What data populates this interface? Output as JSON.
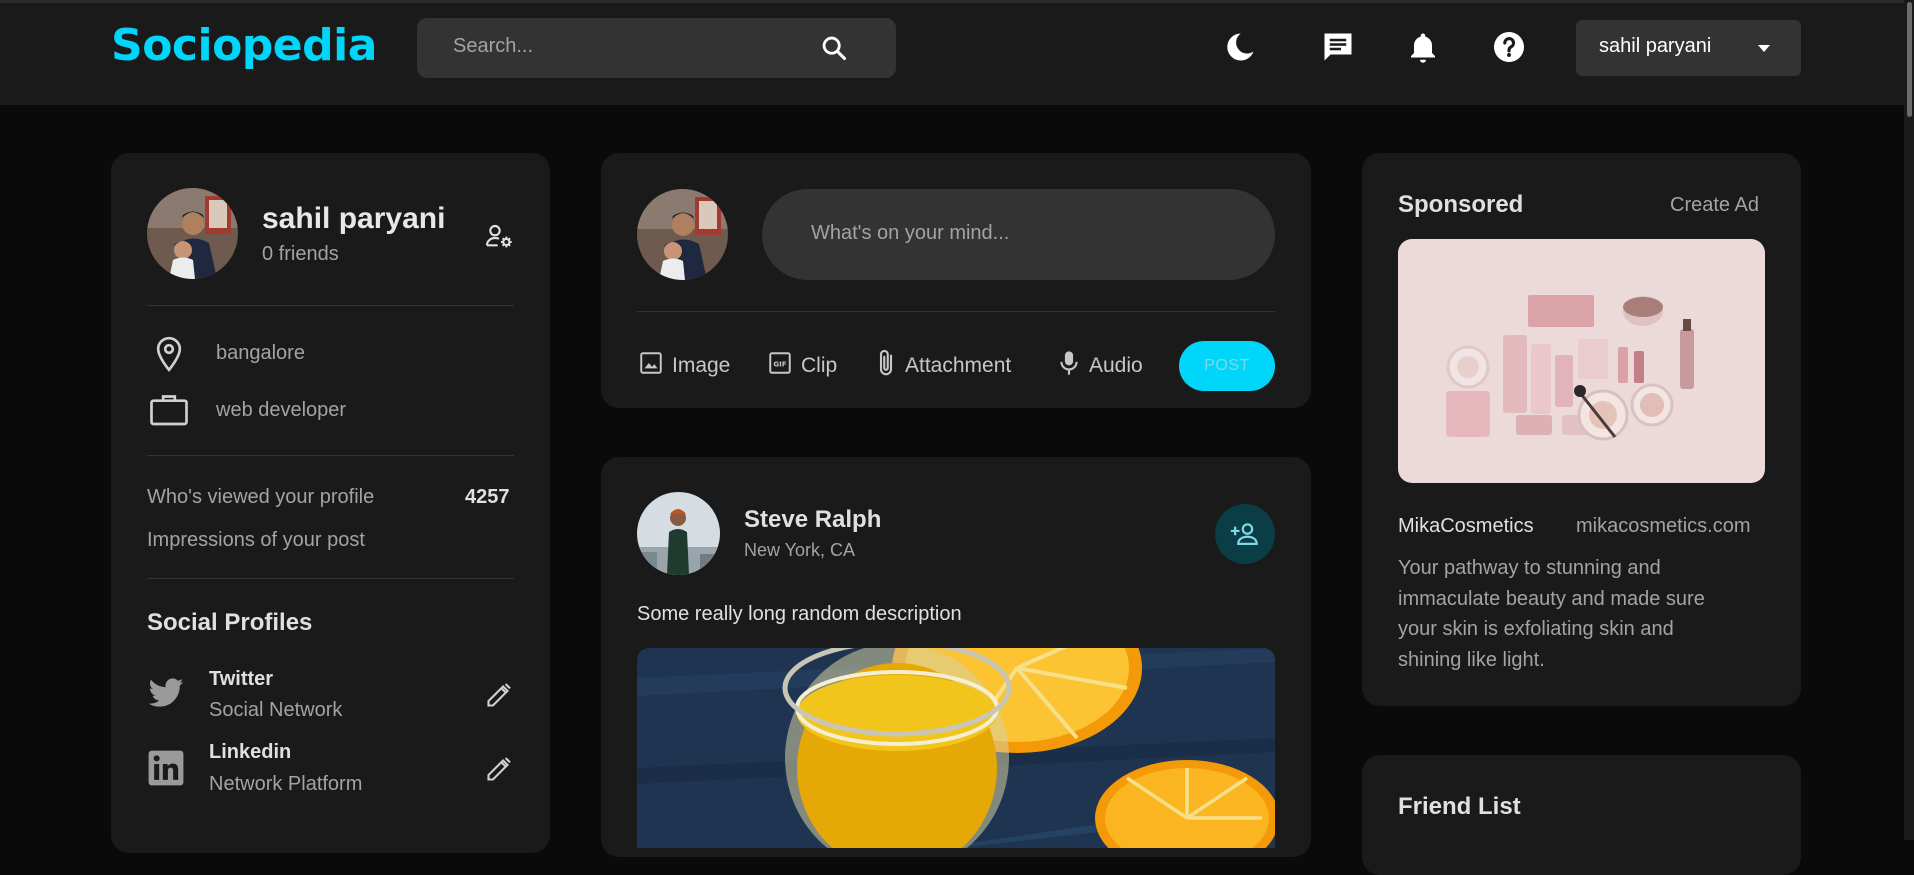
{
  "navbar": {
    "logo": "Sociopedia",
    "search_placeholder": "Search...",
    "user_select": "sahil paryani"
  },
  "profile": {
    "name": "sahil paryani",
    "friends": "0 friends",
    "location": "bangalore",
    "occupation": "web developer",
    "viewed_label": "Who's viewed your profile",
    "viewed_value": "4257",
    "impressions_label": "Impressions of your post",
    "social_title": "Social Profiles",
    "socials": [
      {
        "name": "Twitter",
        "type": "Social Network"
      },
      {
        "name": "Linkedin",
        "type": "Network Platform"
      }
    ]
  },
  "composer": {
    "placeholder": "What's on your mind...",
    "tools": [
      "Image",
      "Clip",
      "Attachment",
      "Audio"
    ],
    "post_label": "POST"
  },
  "post": {
    "author": "Steve Ralph",
    "location": "New York, CA",
    "description": "Some really long random description"
  },
  "sponsored": {
    "title": "Sponsored",
    "create_ad": "Create Ad",
    "brand": "MikaCosmetics",
    "site": "mikacosmetics.com",
    "description_lines": [
      "Your pathway to stunning and",
      "immaculate beauty and made sure",
      "your skin is exfoliating skin and",
      "shining like light."
    ]
  },
  "friend_list": {
    "title": "Friend List"
  },
  "colors": {
    "accent": "#00d5fa",
    "background": "#0a0a0a",
    "card": "#1a1a1a",
    "input": "#333333"
  }
}
